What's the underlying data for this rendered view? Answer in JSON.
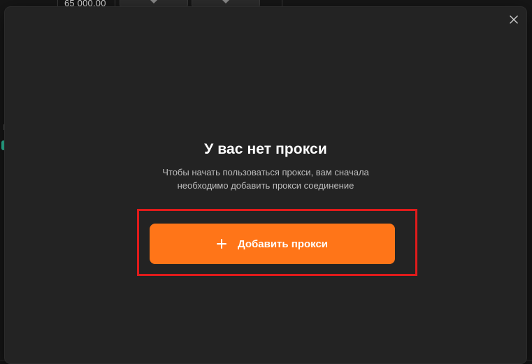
{
  "background": {
    "value_text": "65 000.00"
  },
  "modal": {
    "title": "У вас нет прокси",
    "description_line1": "Чтобы начать пользоваться прокси, вам сначала",
    "description_line2": "необходимо добавить прокси соединение",
    "add_button_label": "Добавить прокси",
    "close_icon": "close-icon",
    "plus_icon": "plus-icon"
  },
  "colors": {
    "accent": "#ff7518",
    "highlight": "#e01b1b",
    "modal_bg": "#232323",
    "page_bg": "#161616",
    "status_dot": "#2fc3a0"
  }
}
